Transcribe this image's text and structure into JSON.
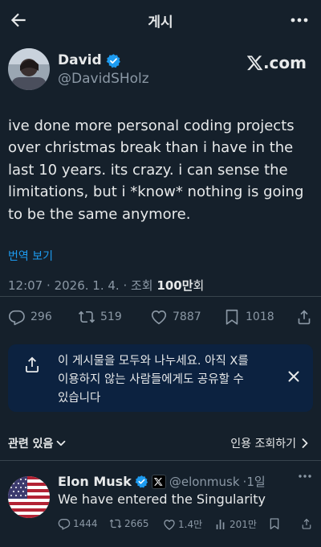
{
  "header": {
    "title": "게시"
  },
  "author": {
    "name": "David",
    "handle": "@DavidSHolz",
    "verified": true,
    "brand": ".com"
  },
  "tweet": {
    "lines": [
      "ive done more personal coding projects",
      "over christmas break than i have in the",
      "last 10 years. its crazy. i can sense the",
      "limitations, but i *know* nothing is going",
      "to be the same anymore."
    ],
    "translate_label": "번역 보기",
    "time": "12:07",
    "date": "2026. 1. 4.",
    "views_label": "조회",
    "views_number": "100",
    "views_unit": "만",
    "views_suffix": "회"
  },
  "actions": {
    "replies": "296",
    "retweets": "519",
    "likes": "7887",
    "bookmarks": "1018"
  },
  "banner": {
    "lines": [
      "이 게시물을 모두와 나누세요. 아직 X를",
      "이용하지 않는 사람들에게도 공유할 수",
      "있습니다"
    ]
  },
  "related": {
    "label": "관련 있음",
    "sort_label": "인용 조회하기"
  },
  "reply": {
    "name": "Elon Musk",
    "handle": "@elonmusk",
    "age": "·1일",
    "text": "We have entered the Singularity",
    "replies": "1444",
    "retweets": "2665",
    "likes": "1.4만",
    "views": "201만"
  },
  "colors": {
    "background": "#15202b",
    "accent": "#1d9bf0",
    "muted": "#8b98a5",
    "banner": "#0c2240"
  }
}
